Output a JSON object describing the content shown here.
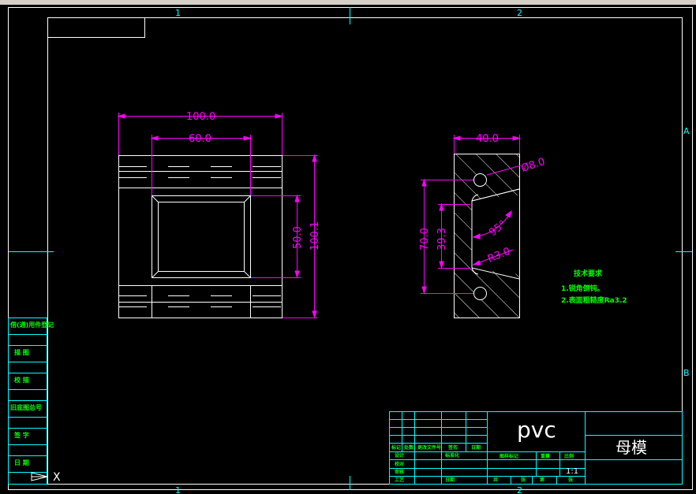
{
  "window": {
    "chrome_color": "#d4d0c8"
  },
  "colors": {
    "frame": "#00ffff",
    "geometry": "#ffffff",
    "dimension": "#ff00ff",
    "text_green": "#00ff00",
    "background": "#000000"
  },
  "zones": {
    "top": [
      "1",
      "2"
    ],
    "bottom": [
      "1",
      "2"
    ],
    "right": [
      "A",
      "B"
    ]
  },
  "front_view": {
    "dims": {
      "width_outer": "100.0",
      "width_inner": "60.0",
      "height_inner": "50.0",
      "height_outer": "100.1"
    }
  },
  "side_view": {
    "dims": {
      "width": "40.0",
      "hole": "Ø8.0",
      "height_total": "70.0",
      "height_slot": "39.3",
      "angle": "95°",
      "radius": "R3.0"
    }
  },
  "tech_req": {
    "title": "技术要求",
    "items": [
      "1.锐角倒钝。",
      "2.表面粗糙度Ra3.2"
    ]
  },
  "left_stamp": [
    "借(通)用件登记",
    "描 图",
    "校 描",
    "旧底图总号",
    "签 字",
    "日 期"
  ],
  "title_block": {
    "material": "pvc",
    "part_name": "母模",
    "scale": "1:1",
    "header_labels": [
      "图样标记",
      "重量",
      "比例"
    ],
    "row_labels": [
      "标记",
      "处数",
      "更改文件号",
      "签名",
      "日期"
    ],
    "left_labels": [
      "设计",
      "标准化",
      "校对",
      "审核",
      "工艺",
      "日期"
    ],
    "sheet_labels": [
      "共",
      "张",
      "第",
      "张"
    ]
  },
  "ucs": {
    "x_label": "X"
  }
}
